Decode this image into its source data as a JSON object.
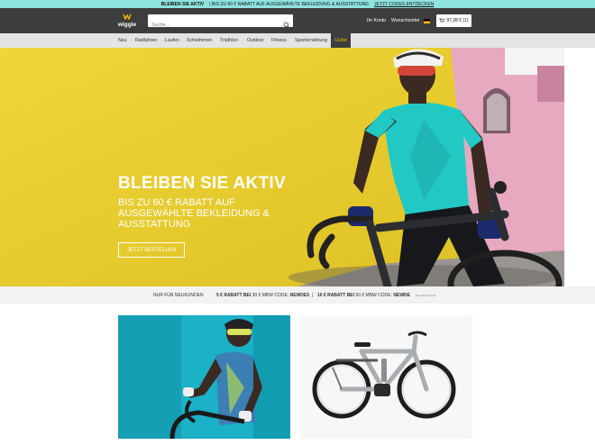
{
  "topbar": {
    "headline": "BLEIBEN SIE AKTIV",
    "text": "| BIS ZU 60 € RABATT AUF AUSGEWÄHLTE BEKLEIDUNG & AUSSTATTUNG",
    "link": "JETZT CODES ENTDECKEN"
  },
  "header": {
    "logo_text": "wiggle",
    "search_placeholder": "Suche...",
    "account": "Ihr Konto",
    "wishlist": "Wunschzettel",
    "cart_label": "97,28 € (1)"
  },
  "nav": {
    "items": [
      "Neu",
      "Radfahren",
      "Laufen",
      "Schwimmen",
      "Triathlon",
      "Outdoor",
      "Fitness",
      "Sporternährung",
      "Outlet"
    ]
  },
  "hero": {
    "title": "BLEIBEN SIE AKTIV",
    "subtitle": "BIS ZU 60 € RABATT AUF AUSGEWÄHLTE BEKLEIDUNG & AUSSTATTUNG",
    "cta": "JETZT BESTELLEN"
  },
  "promo": {
    "label": "NUR FÜR NEUKUNDEN",
    "offer1_bold": "5 € RABATT BEI",
    "offer1_rest": "30 € MBW  CODE:",
    "offer1_code": "NEWDE5",
    "separator": "|",
    "offer2_bold": "10 € RABATT BEI",
    "offer2_rest": "50 € MBW  CODE:",
    "offer2_code": "NEWDE",
    "fine_print": "ES GELTEN AGB"
  },
  "colors": {
    "topbar": "#8fe3e0",
    "header": "#3d3d3d",
    "accent": "#f2b705",
    "hero_bg": "#e9cf2e",
    "jersey": "#22c9c4"
  },
  "icons": {
    "search": "search-icon",
    "cart": "cart-icon",
    "flag": "germany-flag-icon"
  }
}
